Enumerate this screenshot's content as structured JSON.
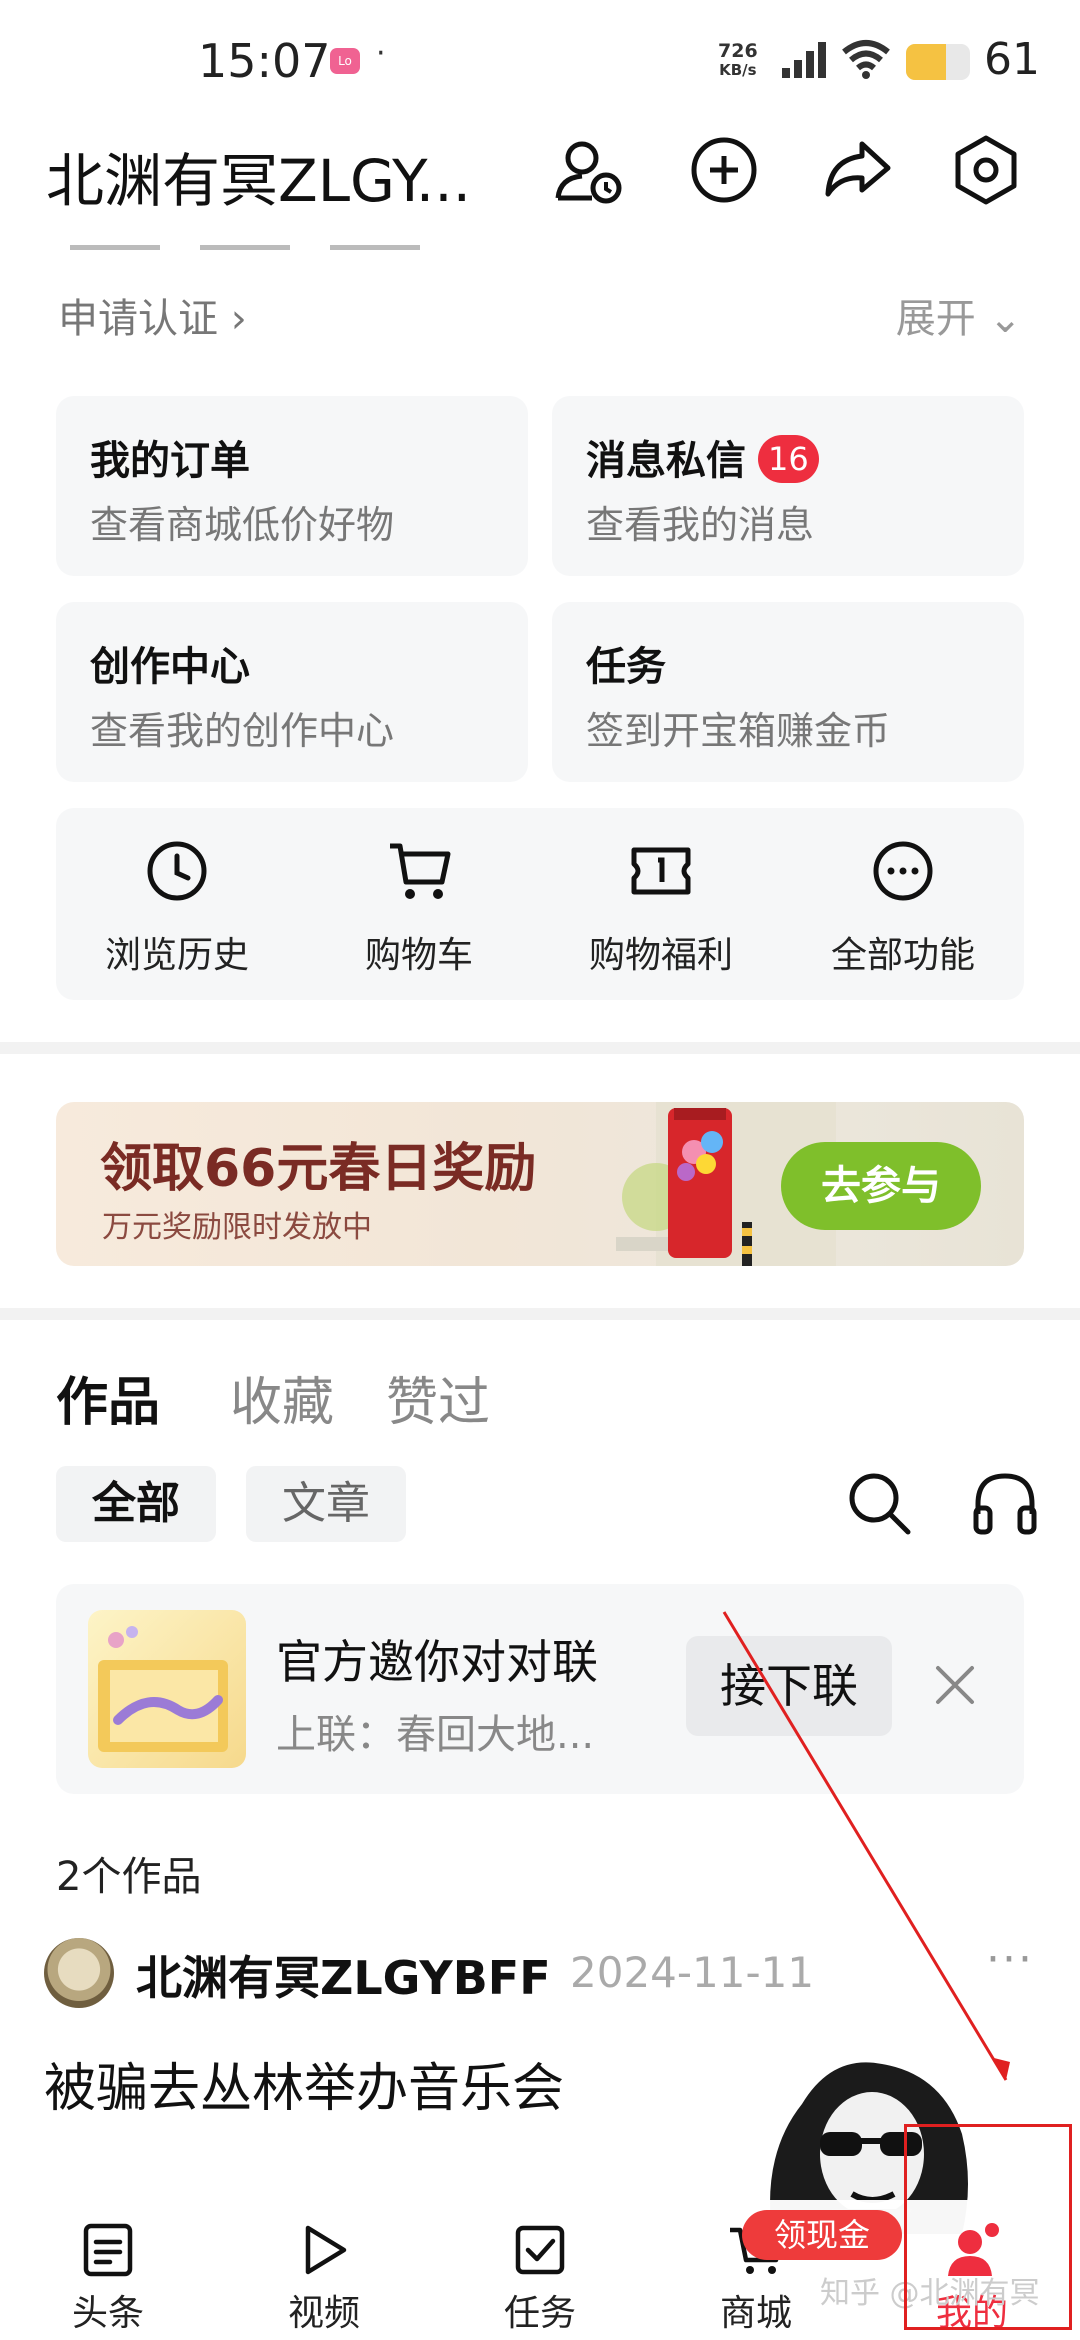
{
  "status_bar": {
    "time": "15:07",
    "app_icon_text": "Lo",
    "dot": "·",
    "net_speed_value": "726",
    "net_speed_unit": "KB/s",
    "battery_level": "61",
    "battery_color": "#f5c242"
  },
  "header": {
    "title": "北渊有冥ZLGY...",
    "icons": [
      "user-time-icon",
      "add-circle-icon",
      "share-icon",
      "settings-hexagon-icon"
    ]
  },
  "profile": {
    "cert_link": "申请认证 ›",
    "expand_link": "展开 ⌄"
  },
  "cards": [
    {
      "title": "我的订单",
      "subtitle": "查看商城低价好物"
    },
    {
      "title": "消息私信",
      "badge": "16",
      "subtitle": "查看我的消息"
    },
    {
      "title": "创作中心",
      "subtitle": "查看我的创作中心"
    },
    {
      "title": "任务",
      "subtitle": "签到开宝箱赚金币"
    }
  ],
  "shortcuts": [
    {
      "label": "浏览历史",
      "icon": "clock-icon"
    },
    {
      "label": "购物车",
      "icon": "cart-icon"
    },
    {
      "label": "购物福利",
      "icon": "coupon-icon"
    },
    {
      "label": "全部功能",
      "icon": "more-circle-icon"
    }
  ],
  "banner": {
    "title": "领取66元春日奖励",
    "subtitle": "万元奖励限时发放中",
    "button": "去参与",
    "accent": "#7fbf2b"
  },
  "tabs": {
    "items": [
      "作品",
      "收藏",
      "赞过"
    ],
    "active": "作品"
  },
  "chips": {
    "items": [
      "全部",
      "文章"
    ],
    "active": "全部"
  },
  "couplet": {
    "title": "官方邀你对对联",
    "subtitle": "上联：春回大地...",
    "button": "接下联"
  },
  "works_count": "2个作品",
  "post": {
    "author": "北渊有冥ZLGYBFF",
    "date": "2024-11-11",
    "more": "···",
    "title": "被骗去丛林举办音乐会"
  },
  "bottom_nav": {
    "items": [
      {
        "label": "头条",
        "icon": "news-icon"
      },
      {
        "label": "视频",
        "icon": "play-icon"
      },
      {
        "label": "任务",
        "icon": "task-check-icon"
      },
      {
        "label": "商城",
        "icon": "mall-cart-icon"
      },
      {
        "label": "我的",
        "icon": "profile-icon"
      }
    ],
    "active": "我的",
    "cash_badge": "领现金",
    "accent": "#ee2e3f"
  },
  "watermark": "知乎 @北渊有冥"
}
